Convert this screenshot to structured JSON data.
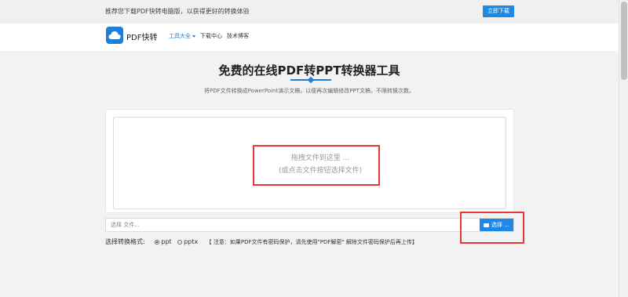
{
  "topbar": {
    "promo_text": "推荐您下载PDF快转电脑版，以获得更好的转换体验",
    "download_button": "立即下载"
  },
  "navbar": {
    "brand": "PDF快转",
    "items": [
      {
        "label": "工具大全"
      },
      {
        "label": "下载中心"
      },
      {
        "label": "技术博客"
      }
    ]
  },
  "main": {
    "title": "免费的在线PDF转PPT转换器工具",
    "subtitle": "将PDF文件转换成PowerPoint演示文稿，以便再次编辑修改PPT文稿，不限转换次数。",
    "drop_hint_line1": "拖拽文件到这里 ...",
    "drop_hint_line2": "(或点击文件按钮选择文件)",
    "file_input_placeholder": "选择 文件...",
    "select_button": "选择 ...",
    "format_label": "选择转换格式:",
    "formats": [
      {
        "label": "ppt",
        "selected": true
      },
      {
        "label": "pptx",
        "selected": false
      }
    ],
    "note": "【 注意：如果PDF文件有密码保护，请先使用\"PDF解密\" 解除文件密码保护后再上传】"
  },
  "colors": {
    "accent": "#1e88e5",
    "highlight": "#e53935"
  },
  "icons": {
    "logo": "cloud-logo-icon",
    "folder": "folder-open-icon",
    "caret": "caret-down-icon"
  }
}
